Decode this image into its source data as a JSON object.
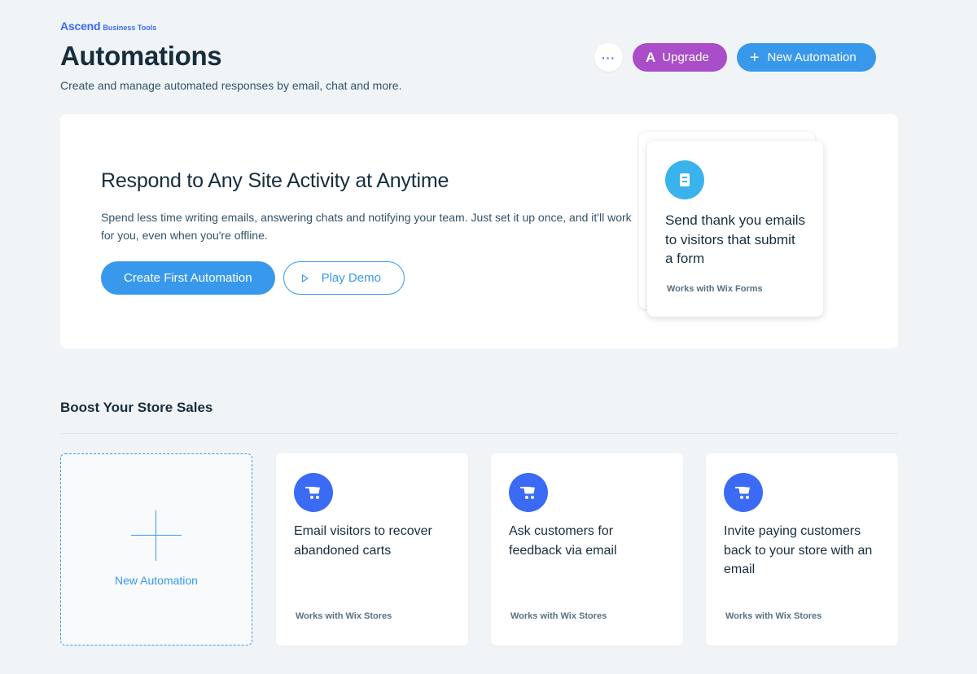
{
  "brand": {
    "name": "Ascend",
    "sub": "Business Tools"
  },
  "header": {
    "title": "Automations",
    "subtitle": "Create and manage automated responses by email, chat and more.",
    "more_label": "···",
    "upgrade_label": "Upgrade",
    "new_automation_label": "New Automation"
  },
  "hero": {
    "title": "Respond to Any Site Activity at Anytime",
    "description": "Spend less time writing emails, answering chats and notifying your team. Just set it up once, and it'll work for you, even when you're offline.",
    "primary_label": "Create First Automation",
    "demo_label": "Play Demo",
    "card": {
      "icon": "form-icon",
      "text": "Send thank you emails to visitors that submit a form",
      "footer": "Works with Wix Forms"
    }
  },
  "section": {
    "title": "Boost Your Store Sales",
    "new_tile_label": "New Automation",
    "cards": [
      {
        "icon": "cart-icon",
        "text": "Email visitors to recover abandoned carts",
        "footer": "Works with Wix Stores"
      },
      {
        "icon": "cart-icon",
        "text": "Ask customers for feedback via email",
        "footer": "Works with Wix Stores"
      },
      {
        "icon": "cart-icon",
        "text": "Invite paying customers back to your store with an email",
        "footer": "Works with Wix Stores"
      }
    ]
  },
  "colors": {
    "accent": "#3899ec",
    "upgrade": "#aa4dc8",
    "brand": "#3b6af5",
    "background": "#f0f4f7"
  }
}
